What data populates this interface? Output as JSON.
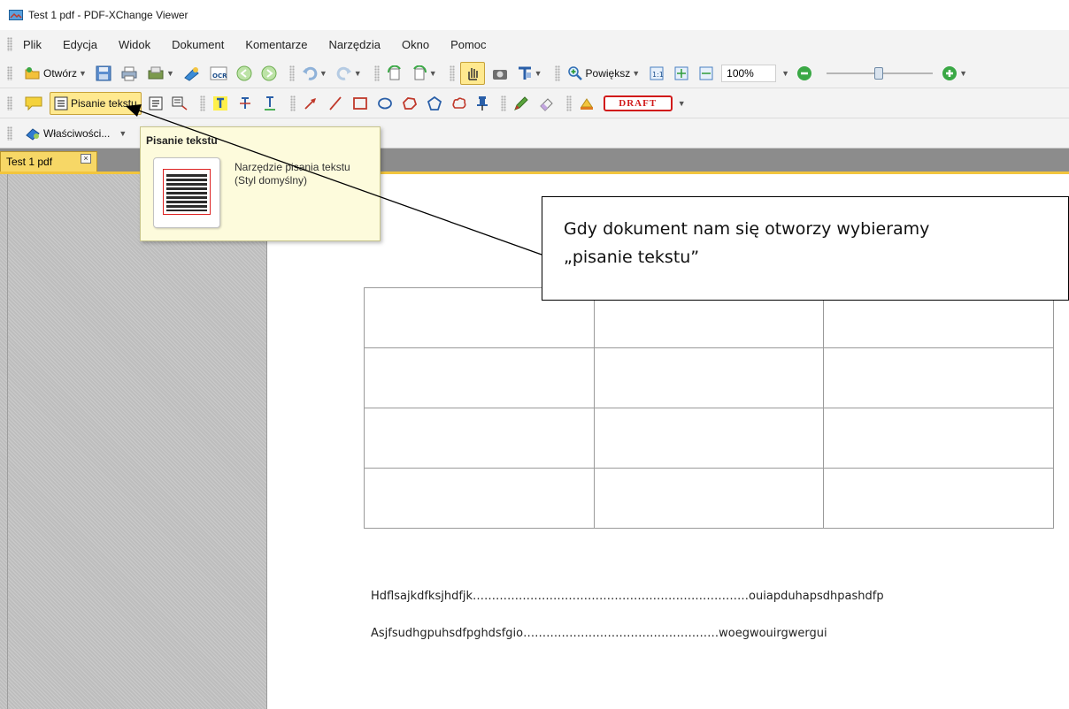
{
  "window": {
    "title": "Test 1 pdf - PDF-XChange Viewer",
    "icon": "pdf-xchange-app-icon"
  },
  "menu": {
    "items": [
      "Plik",
      "Edycja",
      "Widok",
      "Dokument",
      "Komentarze",
      "Narzędzia",
      "Okno",
      "Pomoc"
    ]
  },
  "toolbar1": {
    "open_label": "Otwórz",
    "zoom_in_label": "Powiększ",
    "zoom_value": "100%",
    "icons": [
      "open-folder-icon",
      "save-icon",
      "print-icon",
      "scan-icon",
      "ocr-icon",
      "back-icon",
      "forward-icon",
      "undo-icon",
      "redo-icon",
      "rotate-icon",
      "hand-tool-icon",
      "snapshot-icon",
      "select-text-icon",
      "zoom-in-icon",
      "actual-size-icon",
      "fit-page-icon",
      "fit-width-icon",
      "zoom-minus-icon",
      "zoom-plus-icon"
    ]
  },
  "toolbar2": {
    "typewriter_label": "Pisanie tekstu",
    "stamp_label": "DRAFT",
    "icons": [
      "sticky-note-icon",
      "typewriter-icon",
      "text-box-icon",
      "callout-icon",
      "highlight-text-icon",
      "strikeout-icon",
      "underline-icon",
      "arrow-icon",
      "line-icon",
      "rectangle-icon",
      "oval-icon",
      "polygon-cloud-icon",
      "polygon-icon",
      "cloud-icon",
      "pin-icon",
      "pencil-icon",
      "eraser-icon",
      "stamp-hand-icon",
      "draft-stamp-icon"
    ]
  },
  "toolbar3": {
    "properties_label": "Właściwości..."
  },
  "tab": {
    "label": "Test 1 pdf",
    "close": "×"
  },
  "tooltip": {
    "title": "Pisanie tekstu",
    "line1": "Narzędzie pisania tekstu",
    "line2": "(Styl domyślny)"
  },
  "callout": {
    "line1": "Gdy dokument nam się otworzy wybieramy",
    "line2": "„pisanie tekstu”"
  },
  "document": {
    "table": {
      "rows": 4,
      "cols": 3
    },
    "line1": "Hdflsajkdfksjhdfjk………………………………………………………………ouiapduhapsdhpashdfp",
    "line2": "Asjfsudhgpuhsdfpghdsfgio……………………………………………woegwouirgwergui"
  },
  "colors": {
    "accent": "#f2c53d",
    "active_button": "#ffe98f",
    "stamp_red": "#d11a1a",
    "tooltip_bg": "#fdfbdc",
    "workspace_gray": "#bdbdbd"
  }
}
